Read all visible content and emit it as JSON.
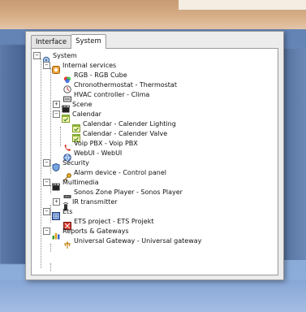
{
  "tabs": [
    {
      "label": "Interface"
    },
    {
      "label": "System"
    }
  ],
  "tree": {
    "system": "System",
    "internal_services": "Internal services",
    "rgb": "RGB - RGB Cube",
    "chrono": "Chronothermostat - Thermostat",
    "hvac": "HVAC controller - Clima",
    "scene": "Scene",
    "calendar": "Calendar",
    "cal_lighting": "Calendar - Calender Lighting",
    "cal_valve": "Calendar - Calender Valve",
    "voip": "Voip PBX - Voip PBX",
    "webui": "WebUI - WebUI",
    "security": "Security",
    "alarm": "Alarm device - Control panel",
    "multimedia": "Multimedia",
    "sonos": "Sonos Zone Player - Sonos Player",
    "ir": "IR transmitter",
    "ets": "Ets",
    "ets_project": "ETS project - ETS Projekt",
    "reports": "Reports & Gateways",
    "gateway": "Universal Gateway - Universal gateway"
  },
  "expanders": {
    "system": "−",
    "internal_services": "−",
    "scene": "+",
    "calendar": "−",
    "security": "−",
    "multimedia": "−",
    "ir": "+",
    "ets": "−",
    "reports": "−"
  },
  "icons": {
    "system": "system-gear-icon",
    "internal_services": "internal-services-icon",
    "rgb": "rgb-cube-icon",
    "chrono": "thermostat-icon",
    "hvac": "hvac-icon",
    "scene": "scene-clapper-icon",
    "calendar": "calendar-icon",
    "calendar_item": "calendar-item-icon",
    "voip": "phone-icon",
    "webui": "globe-icon",
    "security": "shield-icon",
    "alarm": "key-icon",
    "multimedia": "film-icon",
    "sonos": "speaker-icon",
    "ir": "ir-remote-icon",
    "ets": "ets-network-icon",
    "ets_project": "ets-project-icon",
    "reports": "bar-chart-icon",
    "gateway": "gateway-icon"
  }
}
